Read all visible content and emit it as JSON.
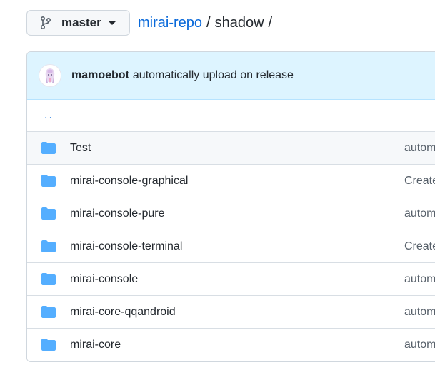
{
  "branch": {
    "name": "master"
  },
  "breadcrumb": {
    "repo": "mirai-repo",
    "separator": "/",
    "current": "shadow",
    "trailing": "/"
  },
  "commit": {
    "author": "mamoebot",
    "message": "automatically upload on release"
  },
  "parent_dir": {
    "label": ".."
  },
  "files": [
    {
      "name": "Test",
      "message": "autom"
    },
    {
      "name": "mirai-console-graphical",
      "message": "Create"
    },
    {
      "name": "mirai-console-pure",
      "message": "autom"
    },
    {
      "name": "mirai-console-terminal",
      "message": "Create"
    },
    {
      "name": "mirai-console",
      "message": "autom"
    },
    {
      "name": "mirai-core-qqandroid",
      "message": "autom"
    },
    {
      "name": "mirai-core",
      "message": "autom"
    }
  ],
  "colors": {
    "link": "#0969da",
    "folder": "#54aeff",
    "commit_bar_bg": "#ddf4ff",
    "border": "#d0d7de"
  },
  "icons": {
    "branch": "git-branch-icon",
    "caret": "caret-down-icon",
    "folder": "folder-icon",
    "avatar": "avatar-image"
  }
}
